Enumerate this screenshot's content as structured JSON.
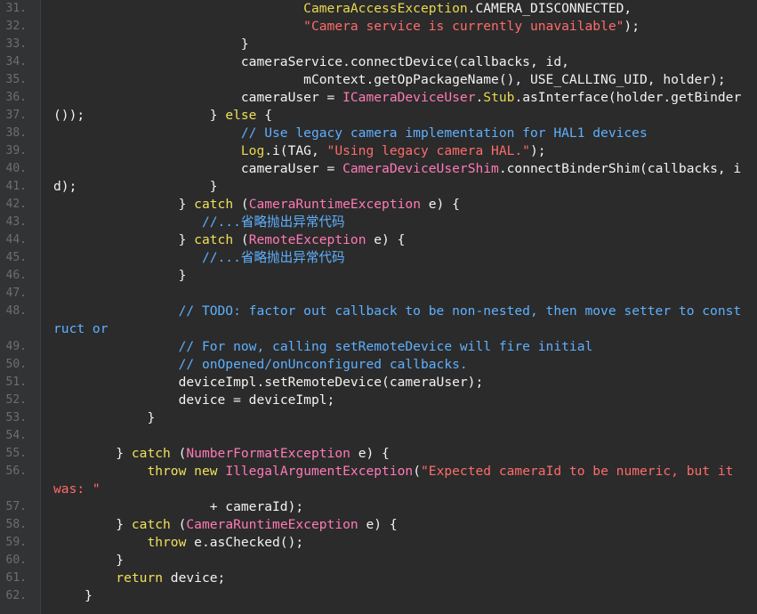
{
  "editor": {
    "colors": {
      "background": "#2b2b2b",
      "gutter": "#313335",
      "plain": "#f2f2f2",
      "keyword": "#f0e05a",
      "comment": "#5eb0ff",
      "string": "#ff6b6b"
    },
    "lines": [
      {
        "n": "31.",
        "wrap": false,
        "segs": [
          [
            "p",
            "                                "
          ],
          [
            "y",
            "CameraAccessException"
          ],
          [
            "p",
            ".CAMERA_DISCONNECTED,"
          ]
        ]
      },
      {
        "n": "32.",
        "wrap": false,
        "segs": [
          [
            "p",
            "                                "
          ],
          [
            "s",
            "\"Camera service is currently unavailable\""
          ],
          [
            "p",
            ");"
          ]
        ]
      },
      {
        "n": "33.",
        "wrap": false,
        "segs": [
          [
            "p",
            "                        }"
          ]
        ]
      },
      {
        "n": "34.",
        "wrap": false,
        "segs": [
          [
            "p",
            "                        cameraService.connectDevice(callbacks, id,"
          ]
        ]
      },
      {
        "n": "35.",
        "wrap": false,
        "segs": [
          [
            "p",
            "                                mContext.getOpPackageName(), USE_CALLING_UID, holder);"
          ]
        ]
      },
      {
        "n": "36.",
        "wrap": false,
        "segs": [
          [
            "p",
            "                        cameraUser = "
          ],
          [
            "m",
            "ICameraDeviceUser"
          ],
          [
            "p",
            "."
          ],
          [
            "y",
            "Stub"
          ],
          [
            "p",
            ".asInterface(holder.getBinder());"
          ]
        ]
      },
      {
        "n": "37.",
        "wrap": false,
        "segs": [
          [
            "p",
            "                    } "
          ],
          [
            "k",
            "else"
          ],
          [
            "p",
            " {"
          ]
        ]
      },
      {
        "n": "38.",
        "wrap": false,
        "segs": [
          [
            "p",
            "                        "
          ],
          [
            "c",
            "// Use legacy camera implementation for HAL1 devices"
          ]
        ]
      },
      {
        "n": "39.",
        "wrap": false,
        "segs": [
          [
            "p",
            "                        "
          ],
          [
            "y",
            "Log"
          ],
          [
            "p",
            ".i(TAG, "
          ],
          [
            "s",
            "\"Using legacy camera HAL.\""
          ],
          [
            "p",
            ");"
          ]
        ]
      },
      {
        "n": "40.",
        "wrap": false,
        "segs": [
          [
            "p",
            "                        cameraUser = "
          ],
          [
            "m",
            "CameraDeviceUserShim"
          ],
          [
            "p",
            ".connectBinderShim(callbacks, id);"
          ]
        ]
      },
      {
        "n": "41.",
        "wrap": false,
        "segs": [
          [
            "p",
            "                    }"
          ]
        ]
      },
      {
        "n": "42.",
        "wrap": false,
        "segs": [
          [
            "p",
            "                } "
          ],
          [
            "k",
            "catch"
          ],
          [
            "p",
            " ("
          ],
          [
            "m",
            "CameraRuntimeException"
          ],
          [
            "p",
            " e) {"
          ]
        ]
      },
      {
        "n": "43.",
        "wrap": false,
        "segs": [
          [
            "p",
            "                   "
          ],
          [
            "c",
            "//...省略抛出异常代码"
          ]
        ]
      },
      {
        "n": "44.",
        "wrap": false,
        "segs": [
          [
            "p",
            "                } "
          ],
          [
            "k",
            "catch"
          ],
          [
            "p",
            " ("
          ],
          [
            "m",
            "RemoteException"
          ],
          [
            "p",
            " e) {"
          ]
        ]
      },
      {
        "n": "45.",
        "wrap": false,
        "segs": [
          [
            "p",
            "                   "
          ],
          [
            "c",
            "//...省略抛出异常代码"
          ]
        ]
      },
      {
        "n": "46.",
        "wrap": false,
        "segs": [
          [
            "p",
            "                }"
          ]
        ]
      },
      {
        "n": "47.",
        "wrap": false,
        "segs": [
          [
            "p",
            ""
          ]
        ]
      },
      {
        "n": "48.",
        "wrap": true,
        "segs": [
          [
            "p",
            "                "
          ],
          [
            "c",
            "// TODO: factor out callback to be non-nested, then move setter to construct or"
          ]
        ]
      },
      {
        "n": "49.",
        "wrap": false,
        "segs": [
          [
            "p",
            "                "
          ],
          [
            "c",
            "// For now, calling setRemoteDevice will fire initial"
          ]
        ]
      },
      {
        "n": "50.",
        "wrap": false,
        "segs": [
          [
            "p",
            "                "
          ],
          [
            "c",
            "// onOpened/onUnconfigured callbacks."
          ]
        ]
      },
      {
        "n": "51.",
        "wrap": false,
        "segs": [
          [
            "p",
            "                deviceImpl.setRemoteDevice(cameraUser);"
          ]
        ]
      },
      {
        "n": "52.",
        "wrap": false,
        "segs": [
          [
            "p",
            "                device = deviceImpl;"
          ]
        ]
      },
      {
        "n": "53.",
        "wrap": false,
        "segs": [
          [
            "p",
            "            }"
          ]
        ]
      },
      {
        "n": "54.",
        "wrap": false,
        "segs": [
          [
            "p",
            ""
          ]
        ]
      },
      {
        "n": "55.",
        "wrap": false,
        "segs": [
          [
            "p",
            "        } "
          ],
          [
            "k",
            "catch"
          ],
          [
            "p",
            " ("
          ],
          [
            "m",
            "NumberFormatException"
          ],
          [
            "p",
            " e) {"
          ]
        ]
      },
      {
        "n": "56.",
        "wrap": true,
        "segs": [
          [
            "p",
            "            "
          ],
          [
            "k",
            "throw"
          ],
          [
            "p",
            " "
          ],
          [
            "k",
            "new"
          ],
          [
            "p",
            " "
          ],
          [
            "m",
            "IllegalArgumentException"
          ],
          [
            "p",
            "("
          ],
          [
            "s",
            "\"Expected cameraId to be numeric, but it was: \""
          ]
        ]
      },
      {
        "n": "57.",
        "wrap": false,
        "segs": [
          [
            "p",
            "                    + cameraId);"
          ]
        ]
      },
      {
        "n": "58.",
        "wrap": false,
        "segs": [
          [
            "p",
            "        } "
          ],
          [
            "k",
            "catch"
          ],
          [
            "p",
            " ("
          ],
          [
            "m",
            "CameraRuntimeException"
          ],
          [
            "p",
            " e) {"
          ]
        ]
      },
      {
        "n": "59.",
        "wrap": false,
        "segs": [
          [
            "p",
            "            "
          ],
          [
            "k",
            "throw"
          ],
          [
            "p",
            " e.asChecked();"
          ]
        ]
      },
      {
        "n": "60.",
        "wrap": false,
        "segs": [
          [
            "p",
            "        }"
          ]
        ]
      },
      {
        "n": "61.",
        "wrap": false,
        "segs": [
          [
            "p",
            "        "
          ],
          [
            "k",
            "return"
          ],
          [
            "p",
            " device;"
          ]
        ]
      },
      {
        "n": "62.",
        "wrap": false,
        "segs": [
          [
            "p",
            "    }"
          ]
        ]
      }
    ]
  }
}
